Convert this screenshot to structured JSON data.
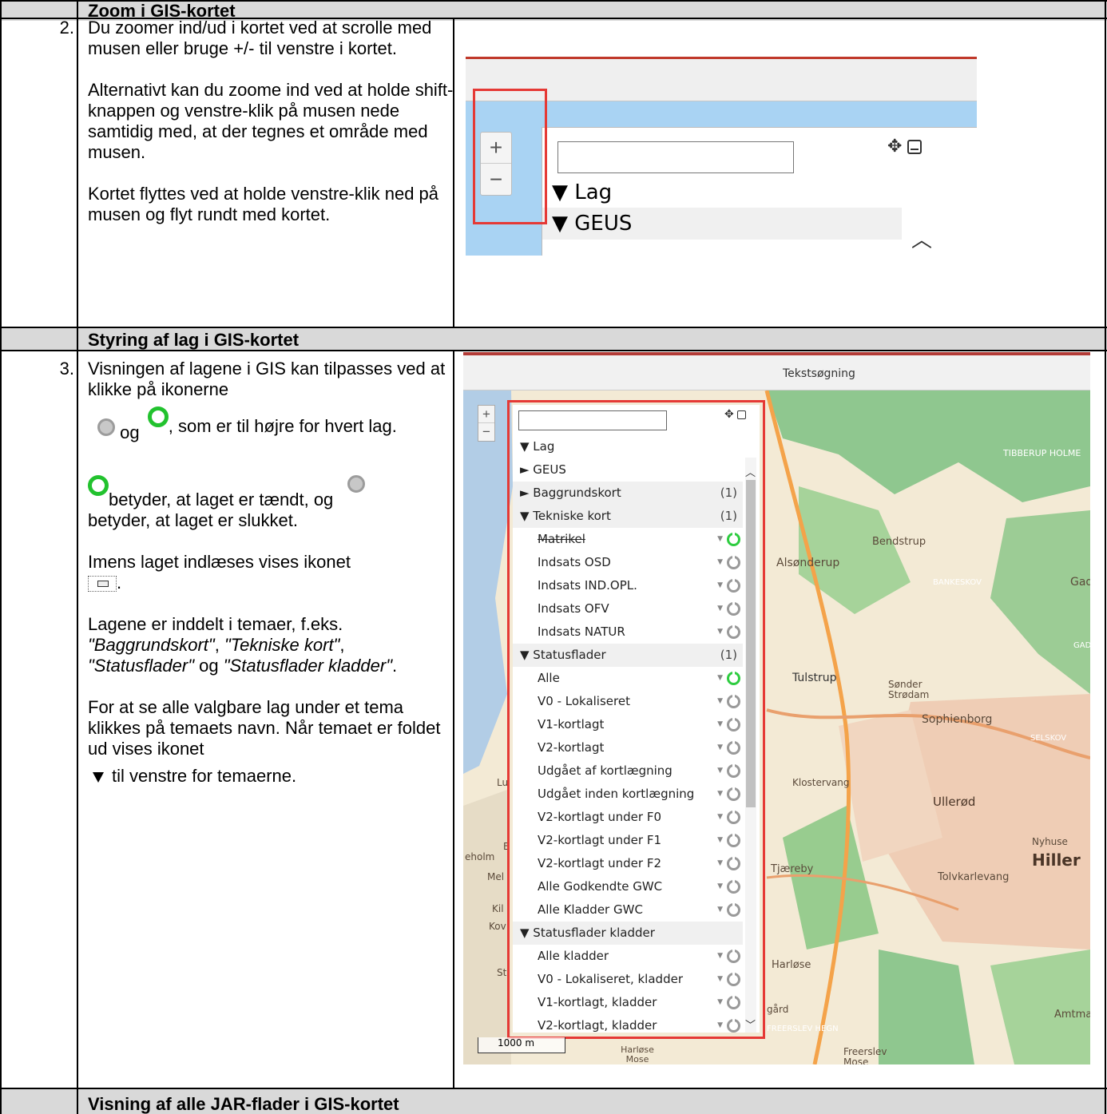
{
  "sections": [
    {
      "title": "Zoom i GIS-kortet"
    },
    {
      "title": "Styring af lag i GIS-kortet"
    },
    {
      "title": "Visning af alle JAR-flader i GIS-kortet"
    }
  ],
  "row2": {
    "number": "2.",
    "p1": "Du zoomer ind/ud i kortet ved at scrolle med musen eller bruge +/- til venstre i kortet.",
    "p2": "Alternativt kan du zoome ind ved at holde shift-knappen og venstre-klik på musen nede samtidig med, at der tegnes et område med musen.",
    "p3": "Kortet flyttes ved at holde venstre-klik ned på musen og flyt rundt med kortet."
  },
  "row3": {
    "number": "3.",
    "p1a": "Visningen af lagene i GIS kan tilpasses ved at klikke på ikonerne",
    "p1b": "og",
    "p1c": ", som er til højre for hvert lag.",
    "p2a": "betyder, at laget er tændt, og",
    "p2b": "betyder, at laget er slukket.",
    "p3": "Imens laget indlæses vises ikonet",
    "p3end": ".",
    "p4a": "Lagene er inddelt i temaer, f.eks.",
    "p4b": "\"Baggrundskort\"",
    "p4c": ", ",
    "p4d": "\"Tekniske kort\"",
    "p4e": ",",
    "p4f": "\"Statusflader\"",
    "p4g": " og ",
    "p4h": "\"Statusflader kladder\"",
    "p4i": ".",
    "p5": "For at se alle valgbare lag under et tema klikkes på temaets navn. Når temaet er foldet ud vises ikonet",
    "p6": "til venstre for temaerne."
  },
  "shot1": {
    "zoom_in": "+",
    "zoom_out": "−",
    "lag": "▼ Lag",
    "geus": "▼ GEUS"
  },
  "shot2": {
    "toolbar_label": "Tekstsøgning",
    "scale": "1000 m",
    "layers": [
      {
        "label": "▼ Lag",
        "type": "root"
      },
      {
        "label": "► GEUS",
        "type": "root"
      },
      {
        "label": "► Baggrundskort",
        "type": "group",
        "count": "(1)"
      },
      {
        "label": "▼ Tekniske kort",
        "type": "group",
        "count": "(1)"
      },
      {
        "label": "Matrikel",
        "type": "layer",
        "state": "on",
        "strike": true
      },
      {
        "label": "Indsats OSD",
        "type": "layer",
        "state": "off"
      },
      {
        "label": "Indsats IND.OPL.",
        "type": "layer",
        "state": "off"
      },
      {
        "label": "Indsats OFV",
        "type": "layer",
        "state": "off"
      },
      {
        "label": "Indsats NATUR",
        "type": "layer",
        "state": "off"
      },
      {
        "label": "▼ Statusflader",
        "type": "group",
        "count": "(1)"
      },
      {
        "label": "Alle",
        "type": "layer",
        "state": "on"
      },
      {
        "label": "V0 - Lokaliseret",
        "type": "layer",
        "state": "off"
      },
      {
        "label": "V1-kortlagt",
        "type": "layer",
        "state": "off"
      },
      {
        "label": "V2-kortlagt",
        "type": "layer",
        "state": "off"
      },
      {
        "label": "Udgået af kortlægning",
        "type": "layer",
        "state": "off"
      },
      {
        "label": "Udgået inden kortlægning",
        "type": "layer",
        "state": "off"
      },
      {
        "label": "V2-kortlagt under F0",
        "type": "layer",
        "state": "off"
      },
      {
        "label": "V2-kortlagt under F1",
        "type": "layer",
        "state": "off"
      },
      {
        "label": "V2-kortlagt under F2",
        "type": "layer",
        "state": "off"
      },
      {
        "label": "Alle Godkendte GWC",
        "type": "layer",
        "state": "off"
      },
      {
        "label": "Alle Kladder GWC",
        "type": "layer",
        "state": "off"
      },
      {
        "label": "▼ Statusflader kladder",
        "type": "group",
        "count": ""
      },
      {
        "label": "Alle kladder",
        "type": "layer",
        "state": "off"
      },
      {
        "label": "V0 - Lokaliseret, kladder",
        "type": "layer",
        "state": "off"
      },
      {
        "label": "V1-kortlagt, kladder",
        "type": "layer",
        "state": "off"
      },
      {
        "label": "V2-kortlagt, kladder",
        "type": "layer",
        "state": "off"
      }
    ],
    "place_names": [
      "TIBBERUP HOLME",
      "Bendstrup",
      "Alsønderup",
      "BANKESKOV",
      "Gad",
      "GADEV",
      "Tulstrup",
      "Sønder Strødam",
      "Sophienborg",
      "SELSKOV",
      "Klostervang",
      "Ullerød",
      "Nyhuse",
      "Hiller",
      "Tjæreby",
      "Tolvkarlevang",
      "eholm",
      "Mel",
      "Kil",
      "Kov",
      "Lu",
      "Harløse",
      "gård",
      "FREERSLEV HEGN",
      "Amtma",
      "Harløse Mose",
      "Freerslev Mose",
      "St",
      "B"
    ]
  }
}
